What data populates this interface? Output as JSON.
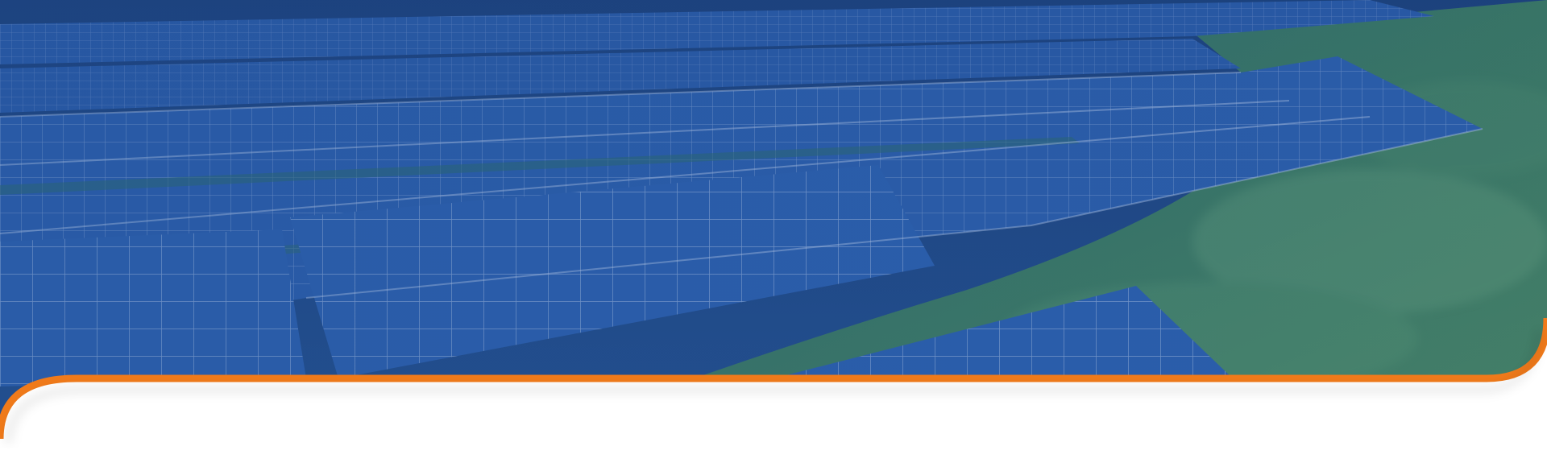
{
  "banner": {
    "image_subject": "solar-panel-field",
    "colors": {
      "overlay_blue": "#1f4f96",
      "panel_blue": "#2a5aa8",
      "panel_grid": "#9fb6dc",
      "grass_green": "#3c7a5e",
      "grass_light": "#5a9a6e",
      "accent_orange": "#f07a1a",
      "background": "#ffffff"
    }
  }
}
